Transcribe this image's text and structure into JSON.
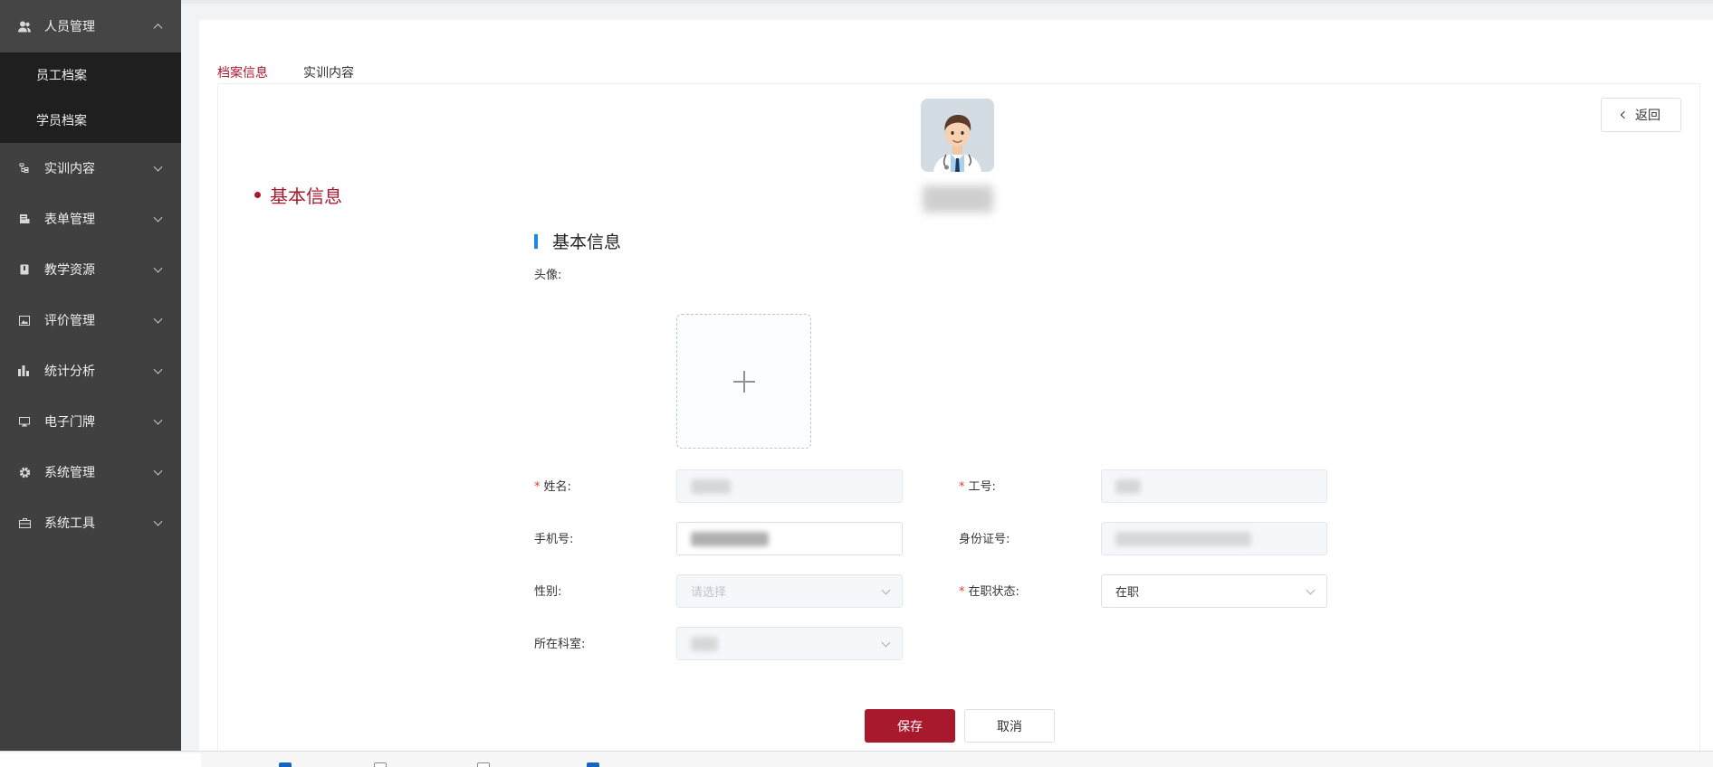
{
  "sidebar": {
    "items": [
      {
        "label": "人员管理",
        "icon": "users-icon",
        "expanded": true,
        "children": [
          {
            "label": "员工档案"
          },
          {
            "label": "学员档案"
          }
        ]
      },
      {
        "label": "实训内容",
        "icon": "tree-icon"
      },
      {
        "label": "表单管理",
        "icon": "form-icon"
      },
      {
        "label": "教学资源",
        "icon": "book-icon"
      },
      {
        "label": "评价管理",
        "icon": "image-icon"
      },
      {
        "label": "统计分析",
        "icon": "bar-chart-icon"
      },
      {
        "label": "电子门牌",
        "icon": "monitor-icon"
      },
      {
        "label": "系统管理",
        "icon": "gear-icon"
      },
      {
        "label": "系统工具",
        "icon": "toolbox-icon"
      }
    ]
  },
  "tabs": [
    {
      "label": "档案信息",
      "active": true
    },
    {
      "label": "实训内容",
      "active": false
    }
  ],
  "back_label": "返回",
  "anchor": {
    "label": "基本信息"
  },
  "section": {
    "title": "基本信息"
  },
  "form": {
    "avatar_label": "头像:",
    "name_label": "姓名:",
    "job_no_label": "工号:",
    "phone_label": "手机号:",
    "id_card_label": "身份证号:",
    "gender_label": "性别:",
    "gender_placeholder": "请选择",
    "status_label": "在职状态:",
    "status_value": "在职",
    "department_label": "所在科室:"
  },
  "buttons": {
    "save": "保存",
    "cancel": "取消"
  },
  "colors": {
    "primary": "#a8192e",
    "sidebar": "#404040",
    "submenu": "#1f1f1f",
    "section_bar": "#1e88e5"
  }
}
